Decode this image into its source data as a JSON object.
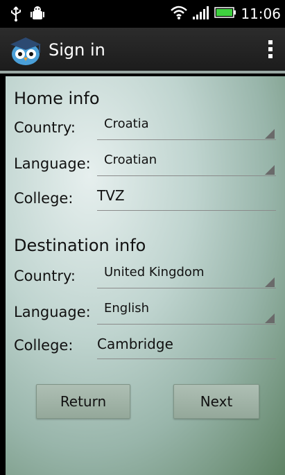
{
  "status_bar": {
    "time": "11:06"
  },
  "action_bar": {
    "title": "Sign in"
  },
  "home_info": {
    "heading": "Home info",
    "country_label": "Country:",
    "country_value": "Croatia",
    "language_label": "Language:",
    "language_value": "Croatian",
    "college_label": "College:",
    "college_value": "TVZ"
  },
  "destination_info": {
    "heading": "Destination info",
    "country_label": "Country:",
    "country_value": "United Kingdom",
    "language_label": "Language:",
    "language_value": "English",
    "college_label": "College:",
    "college_value": "Cambridge"
  },
  "buttons": {
    "return_label": "Return",
    "next_label": "Next"
  },
  "colors": {
    "action_bar": "#1c1c1c",
    "accent_line": "#9aa8a4",
    "background_gradient": "#98b5aa"
  },
  "icons": [
    "usb-icon",
    "android-debug-icon",
    "wifi-icon",
    "signal-icon",
    "battery-icon",
    "app-owl-icon",
    "overflow-menu-icon"
  ]
}
